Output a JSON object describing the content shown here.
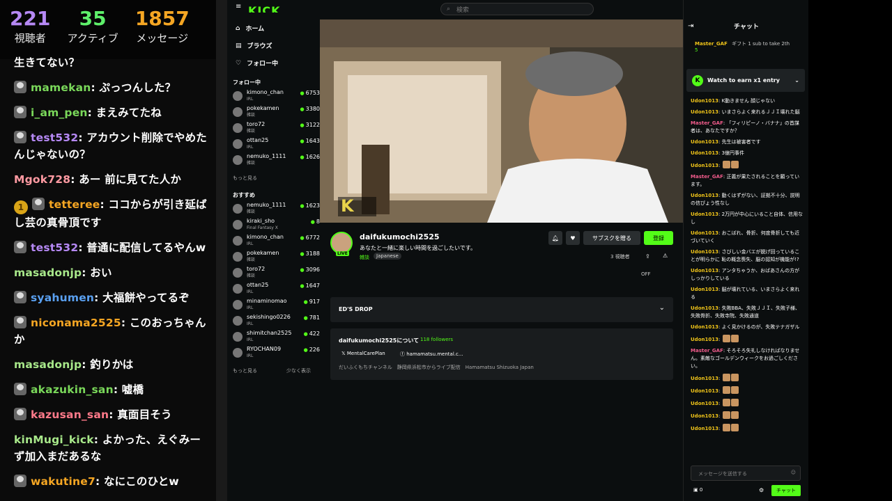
{
  "overlay": {
    "stats": [
      {
        "value": "221",
        "label": "視聴者",
        "color": "#b689f5"
      },
      {
        "value": "35",
        "label": "アクティブ",
        "color": "#5ef06a"
      },
      {
        "value": "1857",
        "label": "メッセージ",
        "color": "#f5a623"
      }
    ],
    "messages": [
      {
        "user": "",
        "text": "生きてない？",
        "color": "#ffffff",
        "avatar": false,
        "badge": ""
      },
      {
        "user": "mamekan",
        "text": ": ぷっつんした？",
        "color": "#7ad85a",
        "avatar": true,
        "badge": ""
      },
      {
        "user": "i_am_pen",
        "text": ": まえみてたね",
        "color": "#7ad85a",
        "avatar": true,
        "badge": ""
      },
      {
        "user": "test532",
        "text": ": アカウント削除でやめたんじゃないの？",
        "color": "#b689f5",
        "avatar": true,
        "badge": ""
      },
      {
        "user": "Mgok728",
        "text": ": あー 前に見てた人か",
        "color": "#ff9aa2",
        "avatar": false,
        "badge": ""
      },
      {
        "user": "tetteree",
        "text": ": ココからが引き延ばし芸の真骨頂です",
        "color": "#f5a623",
        "avatar": true,
        "badge": "1"
      },
      {
        "user": "test532",
        "text": ": 普通に配信してるやんw",
        "color": "#b689f5",
        "avatar": true,
        "badge": ""
      },
      {
        "user": "masadonjp",
        "text": ": おい",
        "color": "#a8e88a",
        "avatar": false,
        "badge": ""
      },
      {
        "user": "syahumen",
        "text": ": 大福餅やってるぞ",
        "color": "#5aa0f0",
        "avatar": true,
        "badge": ""
      },
      {
        "user": "niconama2525",
        "text": ": このおっちゃんか",
        "color": "#f5a623",
        "avatar": true,
        "badge": ""
      },
      {
        "user": "masadonjp",
        "text": ": 釣りかは",
        "color": "#a8e88a",
        "avatar": false,
        "badge": ""
      },
      {
        "user": "akazukin_san",
        "text": ": 嘘橋",
        "color": "#7ad85a",
        "avatar": true,
        "badge": ""
      },
      {
        "user": "kazusan_san",
        "text": ": 真面目そう",
        "color": "#ff7a8a",
        "avatar": true,
        "badge": ""
      },
      {
        "user": "kinMugi_kick",
        "text": ": よかった、えぐみーず加入まだあるな",
        "color": "#a8e88a",
        "avatar": false,
        "badge": ""
      },
      {
        "user": "wakutine7",
        "text": ": なにこのひとw",
        "color": "#f5a623",
        "avatar": true,
        "badge": ""
      }
    ]
  },
  "kick": {
    "logo": "KICK",
    "search_placeholder": "検索",
    "nav": [
      "ホーム",
      "ブラウズ",
      "フォロー中"
    ],
    "following_title": "フォロー中",
    "following": [
      {
        "name": "kimono_chan",
        "cat": "IRL",
        "viewers": "6753"
      },
      {
        "name": "pokekamen",
        "cat": "雑談",
        "viewers": "3380"
      },
      {
        "name": "toro72",
        "cat": "雑談",
        "viewers": "3122"
      },
      {
        "name": "ottan25",
        "cat": "IRL",
        "viewers": "1643"
      },
      {
        "name": "nemuko_1111",
        "cat": "雑談",
        "viewers": "1626"
      }
    ],
    "more": "もっと見る",
    "less": "少なく表示",
    "recommended_title": "おすすめ",
    "recommended": [
      {
        "name": "nemuko_1111",
        "cat": "雑談",
        "viewers": "1623"
      },
      {
        "name": "kiraki_sho",
        "cat": "Final Fantasy X",
        "viewers": "8"
      },
      {
        "name": "kimono_chan",
        "cat": "IRL",
        "viewers": "6772"
      },
      {
        "name": "pokekamen",
        "cat": "雑談",
        "viewers": "3188"
      },
      {
        "name": "toro72",
        "cat": "雑談",
        "viewers": "3096"
      },
      {
        "name": "ottan25",
        "cat": "IRL",
        "viewers": "1647"
      },
      {
        "name": "minaminomao",
        "cat": "IRL",
        "viewers": "917"
      },
      {
        "name": "sekishingo0226",
        "cat": "IRL",
        "viewers": "781"
      },
      {
        "name": "shimitchan2525",
        "cat": "IRL",
        "viewers": "422"
      },
      {
        "name": "RYOCHAN09",
        "cat": "IRL",
        "viewers": "226"
      }
    ],
    "channel": {
      "name": "daifukumochi2525",
      "title": "あなたと一緒に楽しい時間を過ごしたいです。",
      "category": "雑談",
      "tag": "Japanese",
      "live": "LIVE",
      "viewers": "3 視聴者",
      "sub_btn": "サブスクを贈る",
      "follow_btn": "登録",
      "off": "OFF"
    },
    "drop": "ED'S DROP",
    "about": {
      "title": "daifukumochi2525について",
      "followers": "118 followers",
      "link1": "MentalCarePlan",
      "link2": "hamamatsu.mental.c...",
      "desc": "だいふくもちチャンネル　静岡県浜松市からライブ配信　Hamamatsu Shizuoka Japan"
    }
  },
  "chat": {
    "header": "チャット",
    "pinned_user": "Master_GAF",
    "pinned_count": "5",
    "pinned_gift": "ギフト 1 sub to take 2th",
    "earn": "Watch to earn x1 entry",
    "messages": [
      {
        "user": "Udon1013",
        "text": ": K動きません 顔じゃない",
        "u": "cu"
      },
      {
        "user": "Udon1013",
        "text": ": いまさらよく来れるＪＪＩ壊れた脳",
        "u": "cu"
      },
      {
        "user": "Master_GAF",
        "text": ": 「フィリピーノ・バナナ」の首謀者は、あなたですか？",
        "u": "cu2"
      },
      {
        "user": "Udon1013",
        "text": ": 先生は被害者です",
        "u": "cu"
      },
      {
        "user": "Udon1013",
        "text": ": 3億円事件",
        "u": "cu"
      },
      {
        "user": "Udon1013",
        "text": ": ",
        "u": "cu"
      },
      {
        "user": "Master_GAF",
        "text": ": 正義が果たされることを願っています。",
        "u": "cu2"
      },
      {
        "user": "Udon1013",
        "text": ": 動くはずがない、証拠不十分、説明の信ぴょう性なし",
        "u": "cu"
      },
      {
        "user": "Udon1013",
        "text": ": 2万円が中心にいること自体、信用なし",
        "u": "cu"
      },
      {
        "user": "Udon1013",
        "text": ": おこぼれ、骨折、何度骨折しても近づいていく",
        "u": "cu"
      },
      {
        "user": "Udon1013",
        "text": ": さびしい金バエが脱げ回っていることが明らかに 恥の概念喪失、脳の認知が機能が!?",
        "u": "cu"
      },
      {
        "user": "Udon1013",
        "text": ": アンタちゃうか、おばあさんの方がしっかりしている",
        "u": "cu"
      },
      {
        "user": "Udon1013",
        "text": ": 脳が壊れている、いまさらよく来れる",
        "u": "cu"
      },
      {
        "user": "Udon1013",
        "text": ": 失敗BBA、失敗ＪＪＩ、失敗子様、失敗骨折、失敗寺院、失敗通道",
        "u": "cu"
      },
      {
        "user": "Udon1013",
        "text": ": よく見かけるのが、失敗テナガザル",
        "u": "cu"
      },
      {
        "user": "Udon1013",
        "text": ": ",
        "u": "cu"
      },
      {
        "user": "Master_GAF",
        "text": ": そろそろ失礼しなければなりません。素敵なゴールデンウィークをお過ごしください。",
        "u": "cu2"
      },
      {
        "user": "Udon1013",
        "text": ": ",
        "u": "cu"
      },
      {
        "user": "Udon1013",
        "text": ": ",
        "u": "cu"
      },
      {
        "user": "Udon1013",
        "text": ": ",
        "u": "cu"
      },
      {
        "user": "Udon1013",
        "text": ": ",
        "u": "cu"
      },
      {
        "user": "Udon1013",
        "text": ": ",
        "u": "cu"
      }
    ],
    "input_placeholder": "メッセージを送信する",
    "points": "0",
    "send": "チャット"
  }
}
